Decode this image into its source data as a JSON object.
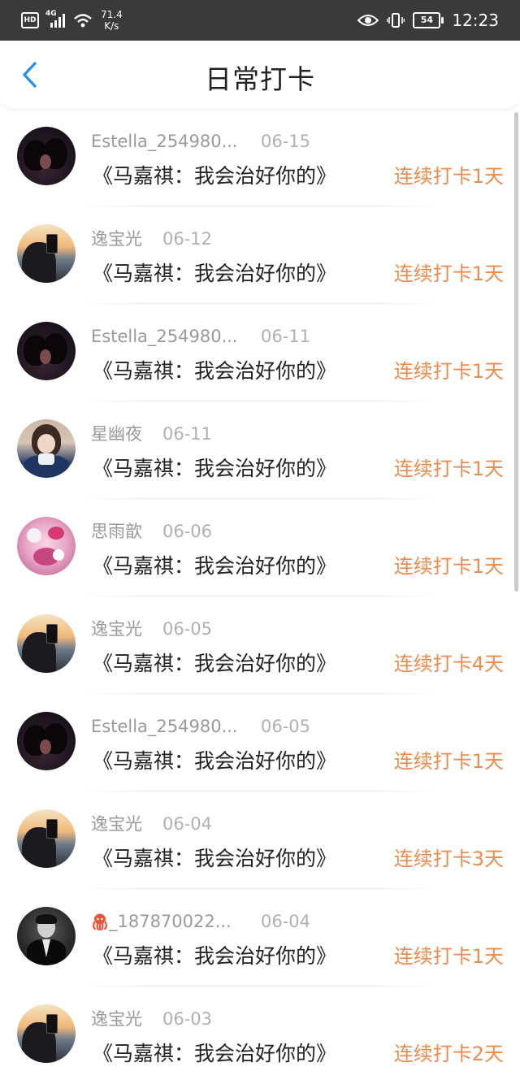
{
  "status_bar": {
    "hd": "HD",
    "signal_gen": "4G",
    "net_speed_value": "71.4",
    "net_speed_unit": "K/s",
    "battery": "54",
    "time": "12:23"
  },
  "header": {
    "title": "日常打卡"
  },
  "colors": {
    "accent_orange": "#f08a4b",
    "back_blue": "#2a8fe8",
    "status_bar_bg": "#3a3a3a"
  },
  "items": [
    {
      "user": "Estella_254980...",
      "date": "06-15",
      "book": "《马嘉祺：我会治好你的》",
      "streak": "连续打卡1天",
      "avatar": "couple"
    },
    {
      "user": "逸宝光",
      "date": "06-12",
      "book": "《马嘉祺：我会治好你的》",
      "streak": "连续打卡1天",
      "avatar": "sunset"
    },
    {
      "user": "Estella_254980...",
      "date": "06-11",
      "book": "《马嘉祺：我会治好你的》",
      "streak": "连续打卡1天",
      "avatar": "couple"
    },
    {
      "user": "星幽夜",
      "date": "06-11",
      "book": "《马嘉祺：我会治好你的》",
      "streak": "连续打卡1天",
      "avatar": "girl"
    },
    {
      "user": "思雨歆",
      "date": "06-06",
      "book": "《马嘉祺：我会治好你的》",
      "streak": "连续打卡1天",
      "avatar": "pink"
    },
    {
      "user": "逸宝光",
      "date": "06-05",
      "book": "《马嘉祺：我会治好你的》",
      "streak": "连续打卡4天",
      "avatar": "sunset"
    },
    {
      "user": "Estella_254980...",
      "date": "06-05",
      "book": "《马嘉祺：我会治好你的》",
      "streak": "连续打卡1天",
      "avatar": "couple"
    },
    {
      "user": "逸宝光",
      "date": "06-04",
      "book": "《马嘉祺：我会治好你的》",
      "streak": "连续打卡3天",
      "avatar": "sunset"
    },
    {
      "user": "_187870022...",
      "date": "06-04",
      "book": "《马嘉祺：我会治好你的》",
      "streak": "连续打卡1天",
      "avatar": "suit",
      "user_icon": "octopus-icon"
    },
    {
      "user": "逸宝光",
      "date": "06-03",
      "book": "《马嘉祺：我会治好你的》",
      "streak": "连续打卡2天",
      "avatar": "sunset"
    }
  ]
}
